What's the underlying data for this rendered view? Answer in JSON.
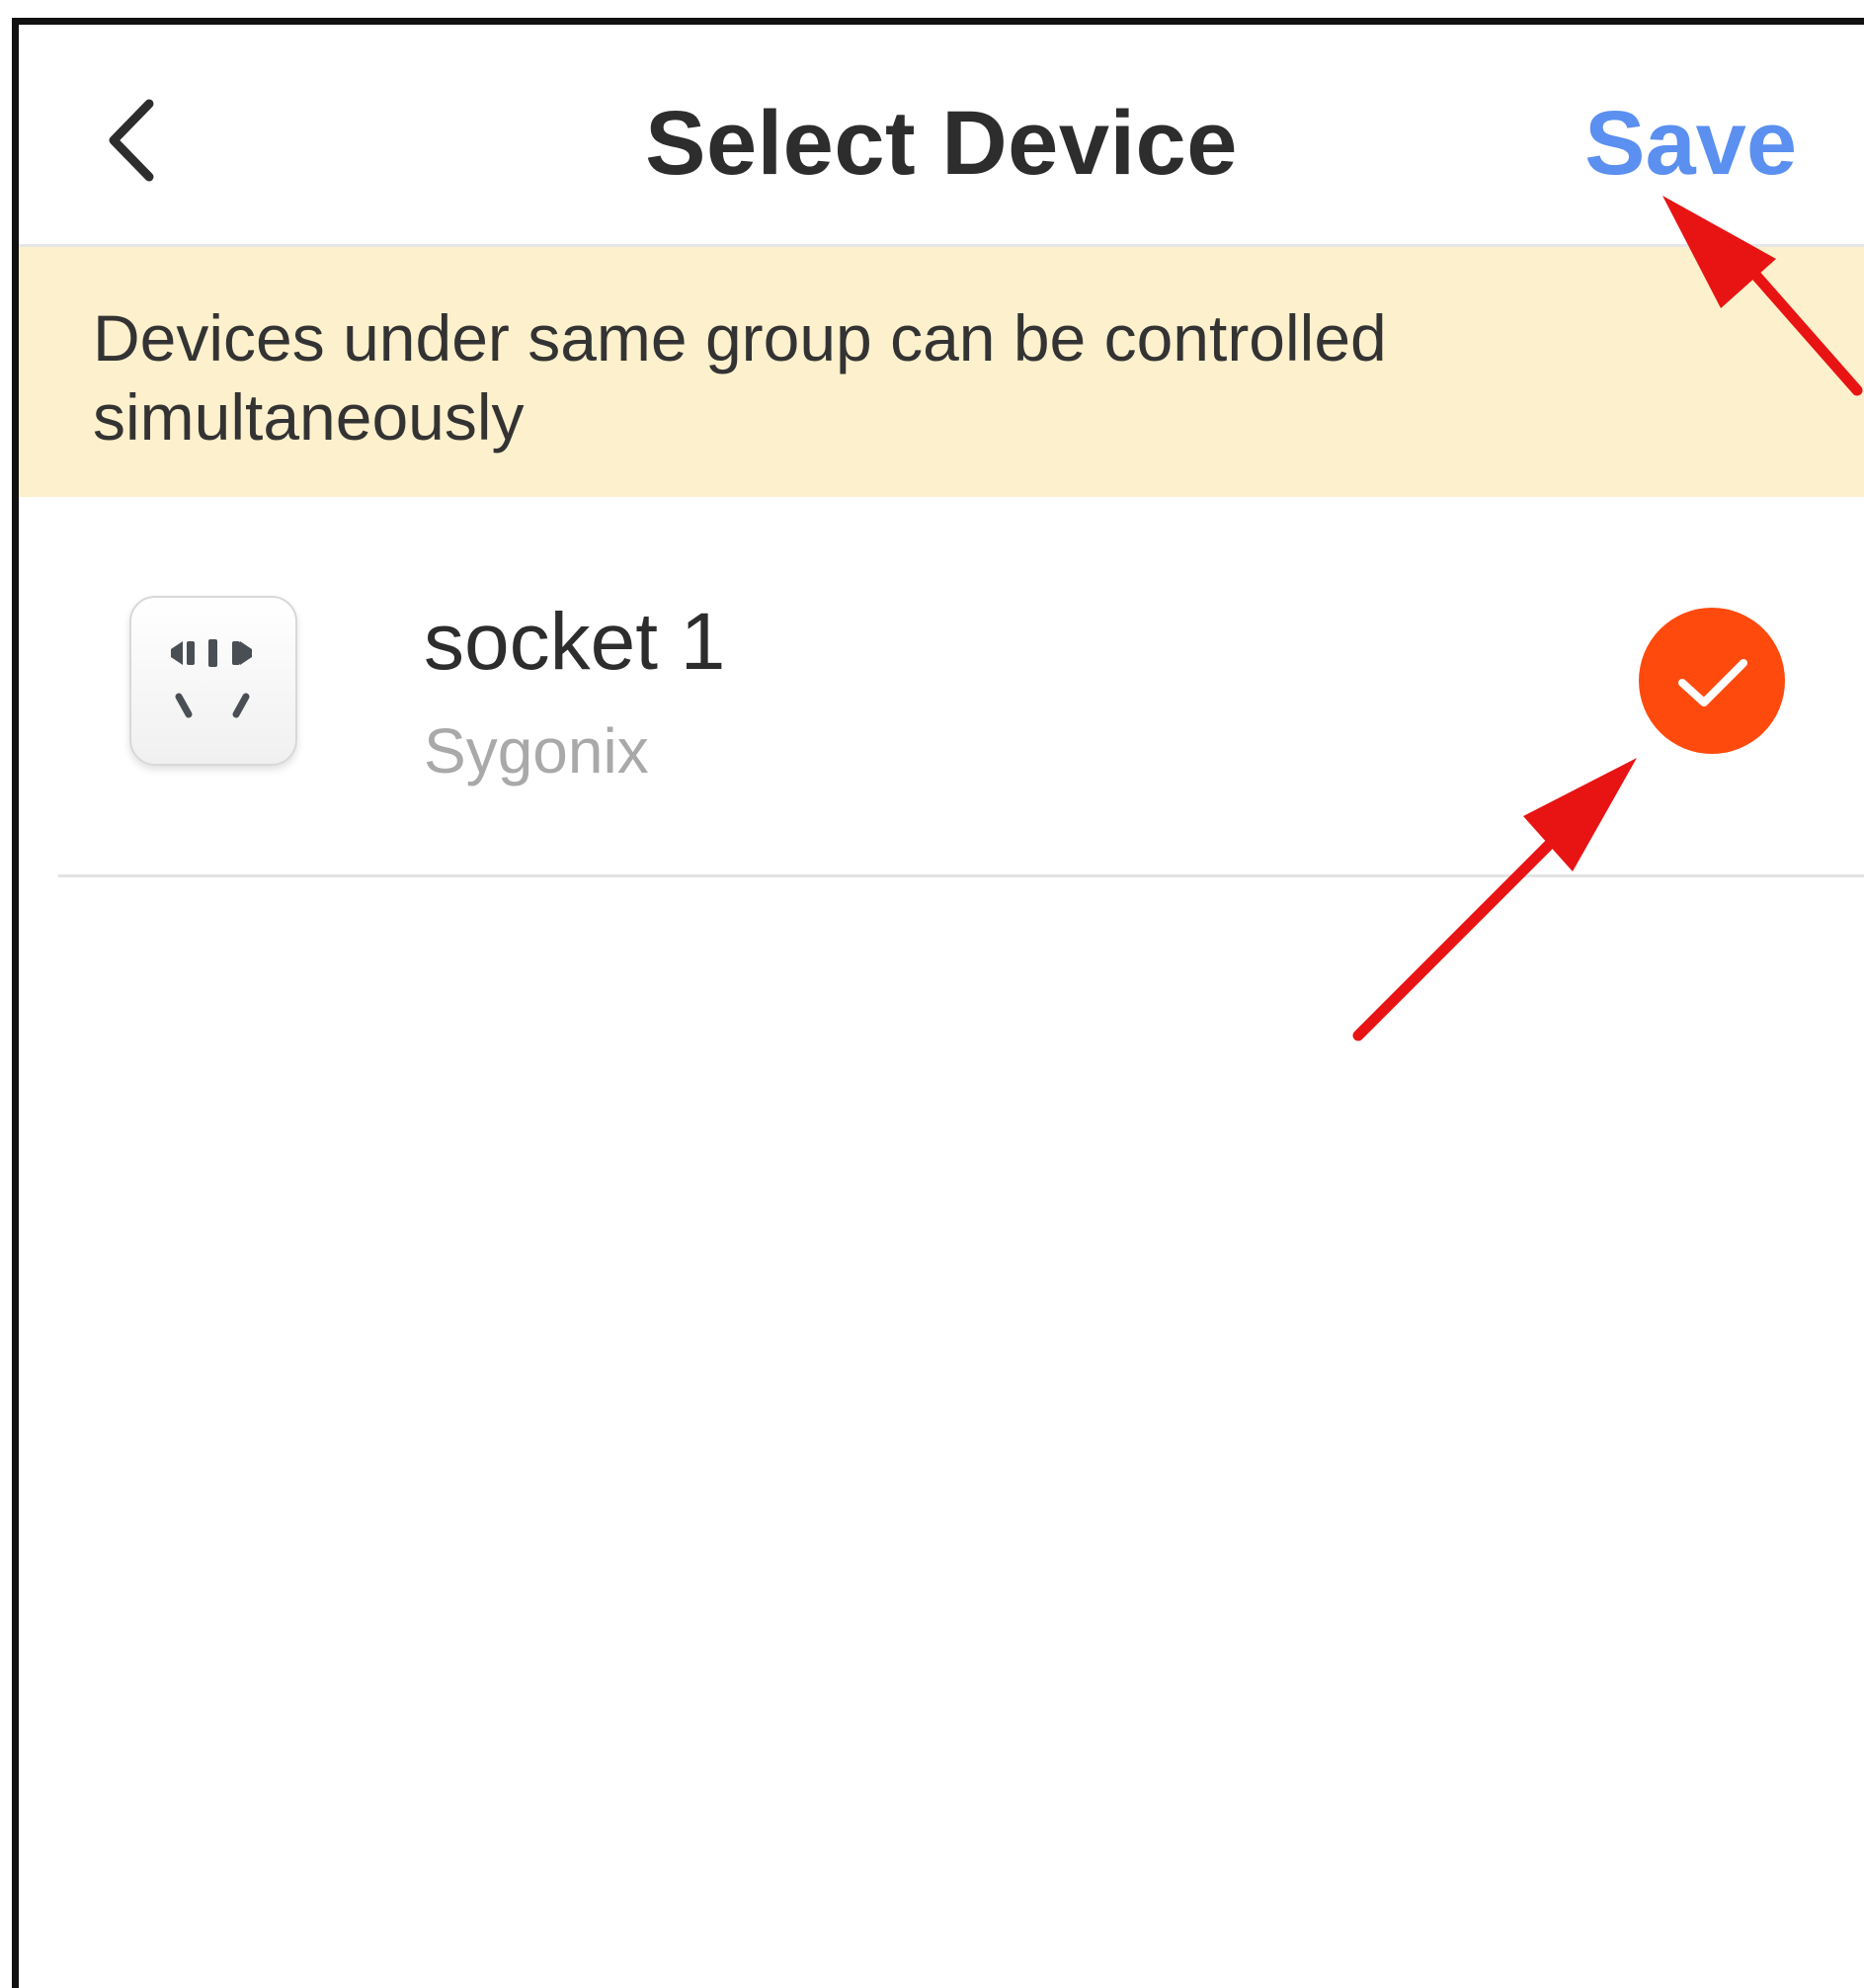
{
  "header": {
    "title": "Select Device",
    "save_label": "Save",
    "back_icon": "chevron-left-icon"
  },
  "notice": {
    "text": "Devices under same group can be controlled simultaneously"
  },
  "devices": [
    {
      "name": "socket 1",
      "brand": "Sygonix",
      "icon": "power-socket-icon",
      "selected": true
    }
  ],
  "colors": {
    "accent_blue": "#5b8ff0",
    "notice_bg": "#fdf0cc",
    "selected_orange": "#ff4a0e",
    "annotation_red": "#e81414"
  }
}
